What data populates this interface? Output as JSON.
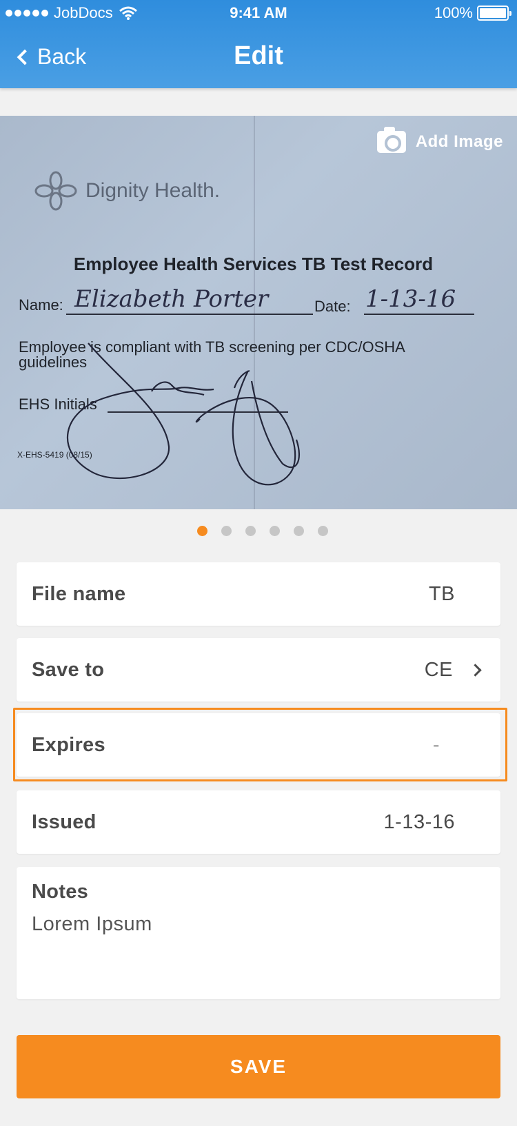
{
  "status_bar": {
    "carrier": "JobDocs",
    "time": "9:41 AM",
    "battery": "100%"
  },
  "nav": {
    "back_label": "Back",
    "title": "Edit"
  },
  "image_viewer": {
    "add_image_label": "Add Image",
    "document": {
      "logo_text": "Dignity Health.",
      "title": "Employee Health Services TB Test Record",
      "name_label": "Name:",
      "name_value": "Elizabeth Porter",
      "date_label": "Date:",
      "date_value": "1-13-16",
      "compliance_text_line1": "Employee is compliant with TB screening per CDC/OSHA",
      "compliance_text_line2": "guidelines",
      "initials_label": "EHS Initials",
      "form_code": "X-EHS-5419 (08/15)"
    },
    "page_count": 6,
    "active_page": 1
  },
  "fields": {
    "file_name": {
      "label": "File name",
      "value": "TB"
    },
    "save_to": {
      "label": "Save to",
      "value": "CE"
    },
    "expires": {
      "label": "Expires",
      "value": "-"
    },
    "issued": {
      "label": "Issued",
      "value": "1-13-16"
    },
    "notes": {
      "label": "Notes",
      "value": "Lorem Ipsum"
    }
  },
  "save_label": "SAVE",
  "colors": {
    "header_blue": "#3a96e0",
    "accent_orange": "#f68b1f",
    "background": "#f1f1f1"
  }
}
